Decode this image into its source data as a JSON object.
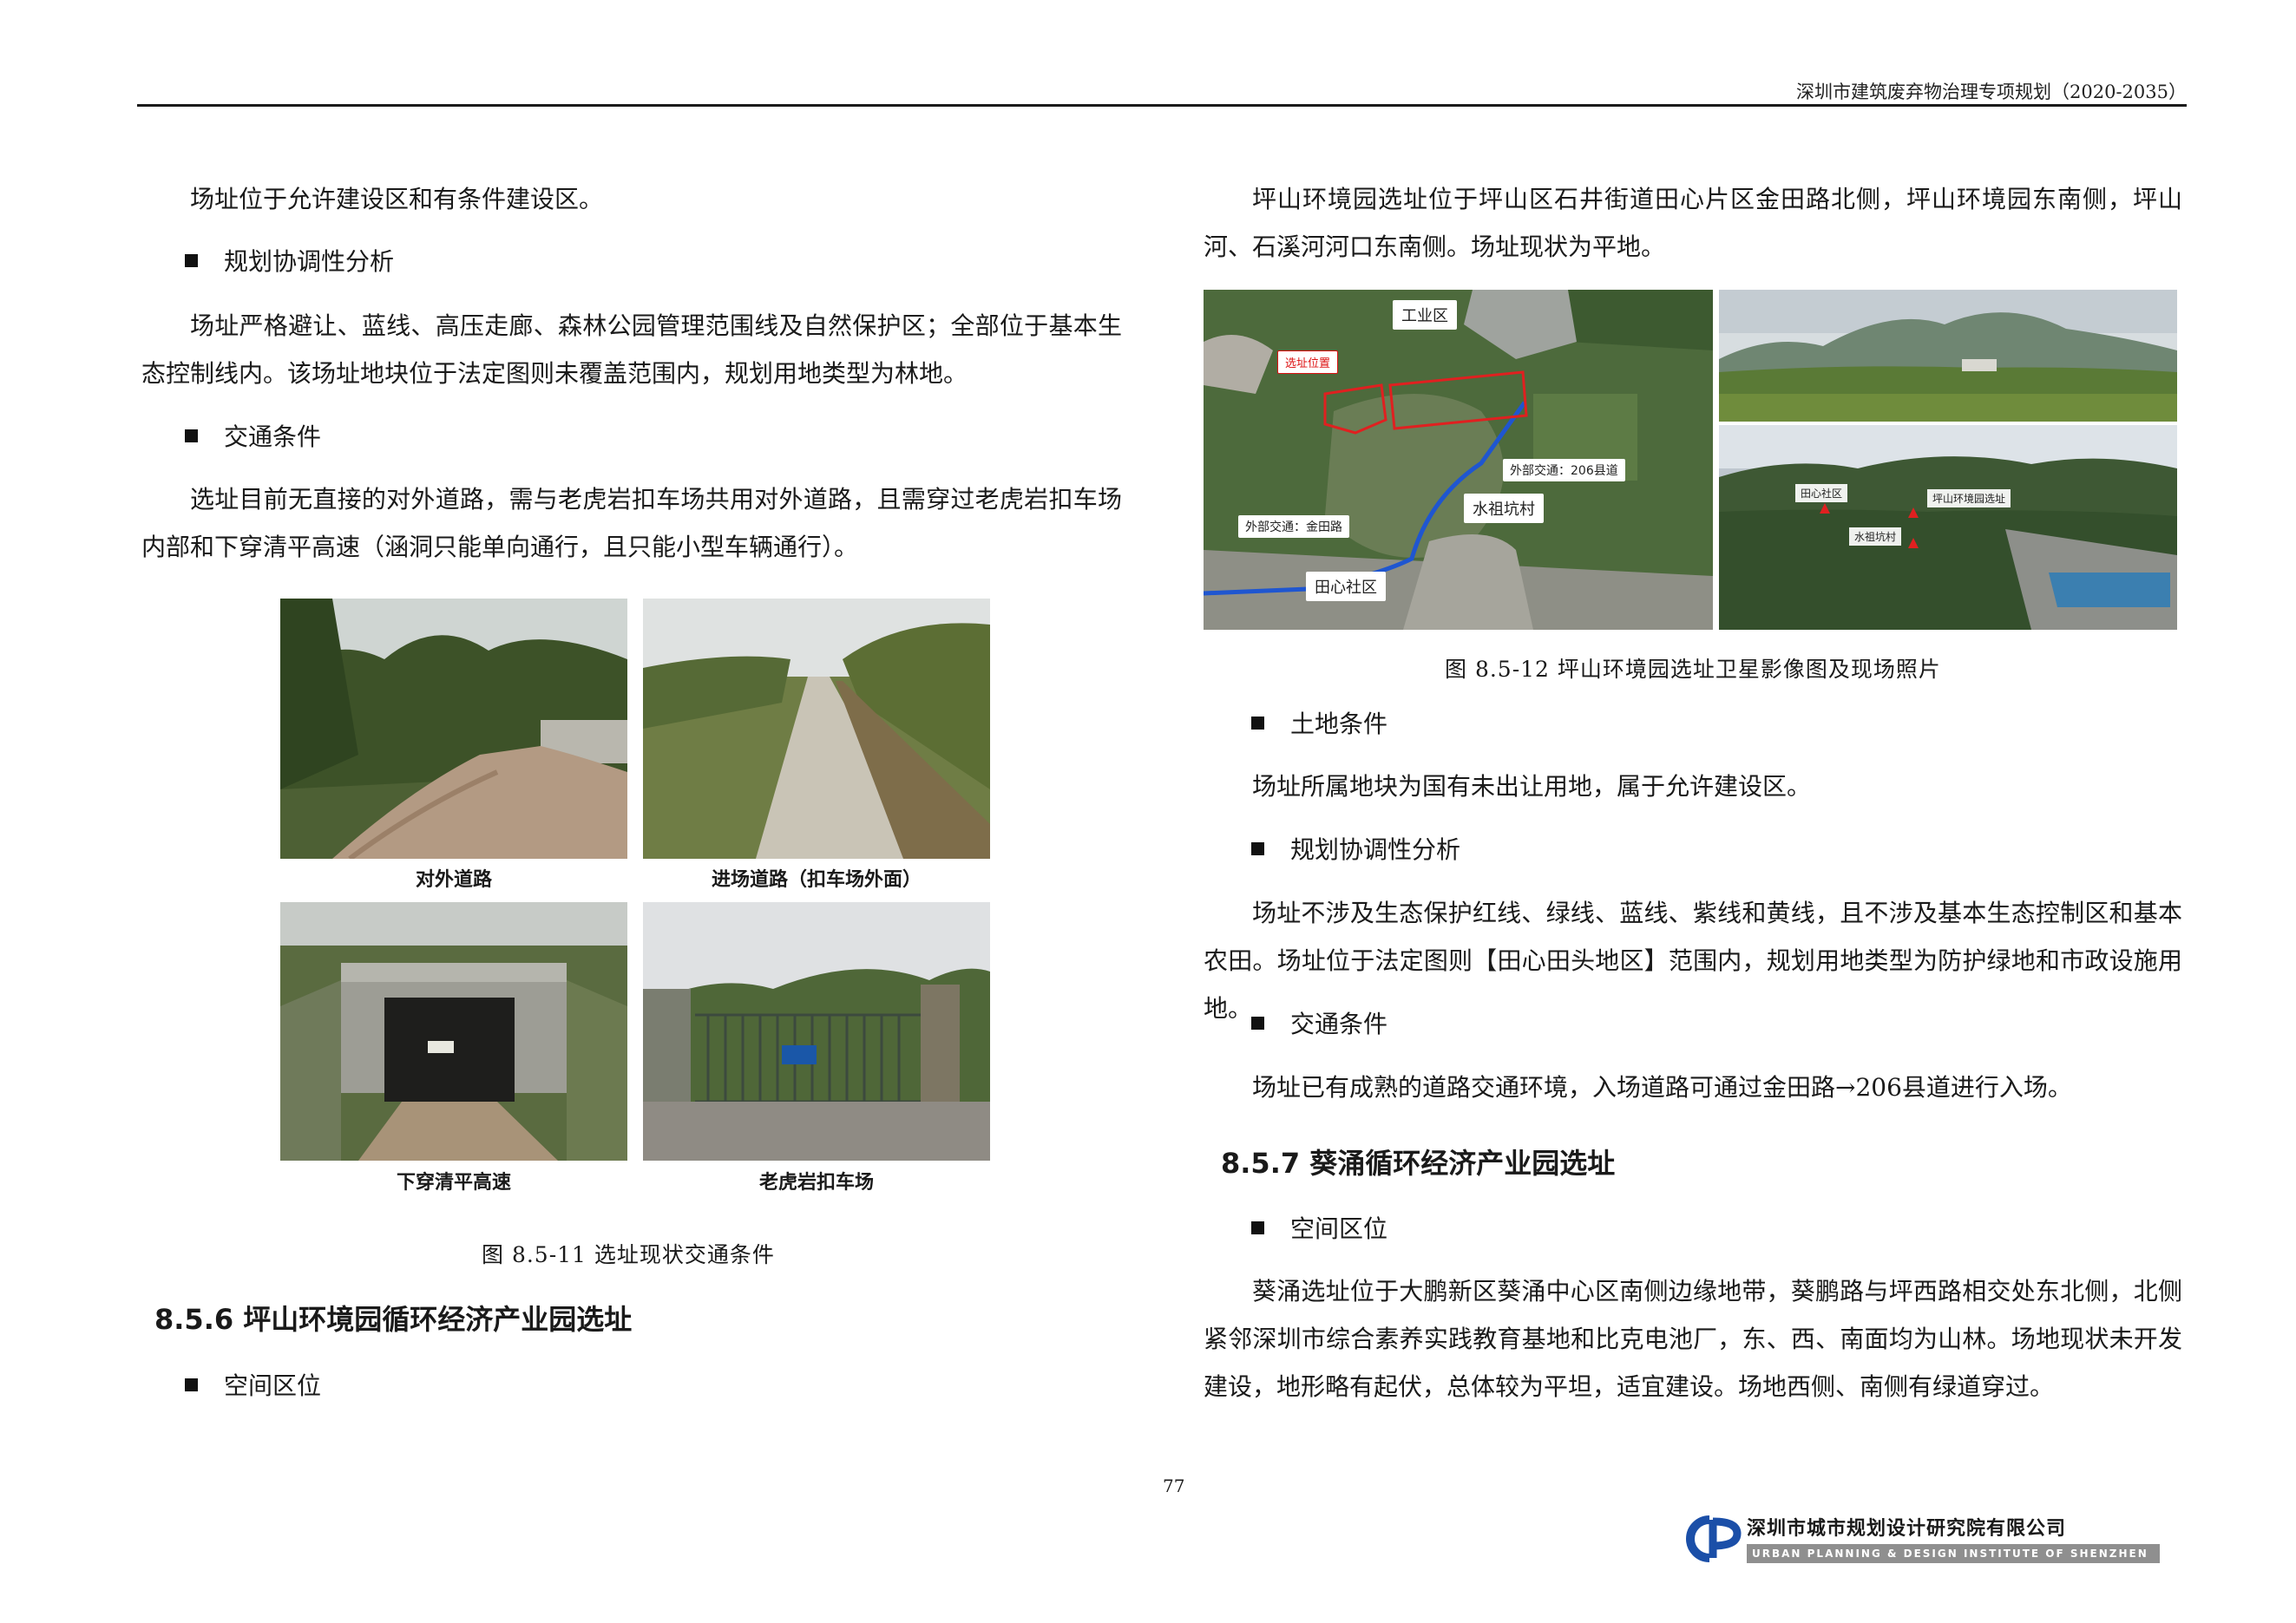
{
  "header": {
    "title": "深圳市建筑废弃物治理专项规划（2020-2035）"
  },
  "left": {
    "p1": "场址位于允许建设区和有条件建设区。",
    "h_plan": "规划协调性分析",
    "p_plan": "场址严格避让、蓝线、高压走廊、森林公园管理范围线及自然保护区；全部位于基本生态控制线内。该场址地块位于法定图则未覆盖范围内，规划用地类型为林地。",
    "h_traffic": "交通条件",
    "p_traffic": "选址目前无直接的对外道路，需与老虎岩扣车场共用对外道路，且需穿过老虎岩扣车场内部和下穿清平高速（涵洞只能单向通行，且只能小型车辆通行）。",
    "photos": [
      {
        "caption": "对外道路"
      },
      {
        "caption": "进场道路（扣车场外面）"
      },
      {
        "caption": "下穿清平高速"
      },
      {
        "caption": "老虎岩扣车场"
      }
    ],
    "fig_caption": "图 8.5-11  选址现状交通条件",
    "section_856": "8.5.6 坪山环境园循环经济产业园选址",
    "h_space": "空间区位"
  },
  "right": {
    "p_intro": "坪山环境园选址位于坪山区石井街道田心片区金田路北侧，坪山环境园东南侧，坪山河、石溪河河口东南侧。场址现状为平地。",
    "map_labels": {
      "industrial": "工业区",
      "site": "选址位置",
      "ext_206": "外部交通：206县道",
      "shuizu": "水祖坑村",
      "ext_jintian": "外部交通：金田路",
      "tianxin": "田心社区"
    },
    "aerial_labels": {
      "tianxin": "田心社区",
      "env_site": "坪山环境园选址",
      "shuizu": "水祖坑村"
    },
    "fig_caption": "图 8.5-12  坪山环境园选址卫星影像图及现场照片",
    "h_land": "土地条件",
    "p_land": "场址所属地块为国有未出让用地，属于允许建设区。",
    "h_plan": "规划协调性分析",
    "p_plan": "场址不涉及生态保护红线、绿线、蓝线、紫线和黄线，且不涉及基本生态控制区和基本农田。场址位于法定图则【田心田头地区】范围内，规划用地类型为防护绿地和市政设施用地。",
    "h_traffic": "交通条件",
    "p_traffic": "场址已有成熟的道路交通环境，入场道路可通过金田路→206县道进行入场。",
    "section_857": "8.5.7 葵涌循环经济产业园选址",
    "h_space": "空间区位",
    "p_space": "葵涌选址位于大鹏新区葵涌中心区南侧边缘地带，葵鹏路与坪西路相交处东北侧，北侧紧邻深圳市综合素养实践教育基地和比克电池厂，东、西、南面均为山林。场地现状未开发建设，地形略有起伏，总体较为平坦，适宜建设。场地西侧、南侧有绿道穿过。"
  },
  "footer": {
    "page_number": "77",
    "logo_cn": "深圳市城市规划设计研究院有限公司",
    "logo_en": "URBAN PLANNING & DESIGN INSTITUTE OF SHENZHEN"
  }
}
